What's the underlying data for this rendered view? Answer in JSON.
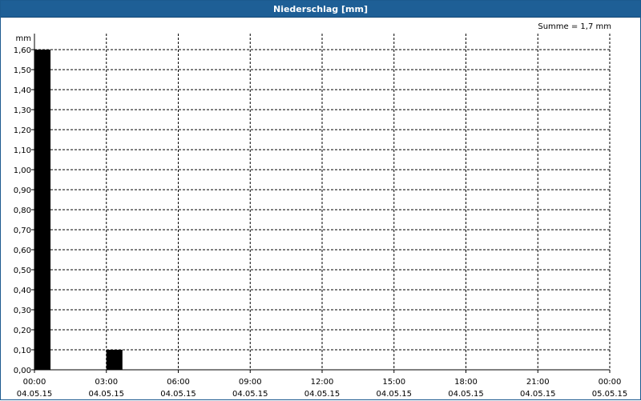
{
  "window": {
    "title": "Niederschlag [mm]"
  },
  "summary": {
    "text": "Summe = 1,7 mm"
  },
  "colors": {
    "titlebar": "#1e5f96",
    "bar": "#000000",
    "grid": "#000000"
  },
  "chart_data": {
    "type": "bar",
    "title": "Niederschlag [mm]",
    "ylabel": "mm",
    "xlabel": "",
    "ylim": [
      0,
      1.6
    ],
    "yticks": [
      "0,00",
      "0,10",
      "0,20",
      "0,30",
      "0,40",
      "0,50",
      "0,60",
      "0,70",
      "0,80",
      "0,90",
      "1,00",
      "1,10",
      "1,20",
      "1,30",
      "1,40",
      "1,50",
      "1,60"
    ],
    "xlim_hours": [
      0,
      24
    ],
    "xticks": [
      {
        "time": "00:00",
        "date": "04.05.15"
      },
      {
        "time": "03:00",
        "date": "04.05.15"
      },
      {
        "time": "06:00",
        "date": "04.05.15"
      },
      {
        "time": "09:00",
        "date": "04.05.15"
      },
      {
        "time": "12:00",
        "date": "04.05.15"
      },
      {
        "time": "15:00",
        "date": "04.05.15"
      },
      {
        "time": "18:00",
        "date": "04.05.15"
      },
      {
        "time": "21:00",
        "date": "04.05.15"
      },
      {
        "time": "00:00",
        "date": "05.05.15"
      }
    ],
    "bars": [
      {
        "start_hour": 0,
        "end_hour": 0.67,
        "value": 1.6
      },
      {
        "start_hour": 3,
        "end_hour": 3.67,
        "value": 0.1
      }
    ],
    "grid": true,
    "summe": "Summe = 1,7 mm"
  }
}
